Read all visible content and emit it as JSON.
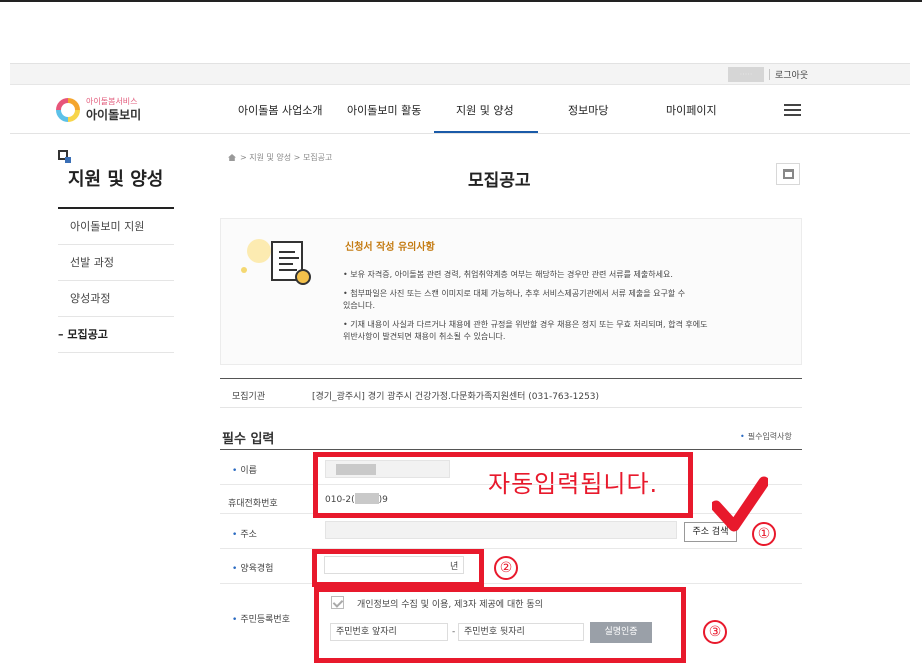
{
  "utility": {
    "user_masked": "·····",
    "logout": "로그아웃"
  },
  "logo": {
    "service": "아이돌봄서비스",
    "name": "아이돌보미"
  },
  "gnb": {
    "items": [
      "아이돌봄 사업소개",
      "아이돌보미 활동",
      "지원 및 양성",
      "정보마당",
      "마이페이지"
    ],
    "active_index": 2
  },
  "sidebar": {
    "title": "지원 및 양성",
    "items": [
      "아이돌보미 지원",
      "선발 과정",
      "양성과정",
      "모집공고"
    ],
    "active_prefix": "– "
  },
  "breadcrumb": [
    "지원 및 양성",
    "모집공고"
  ],
  "page_title": "모집공고",
  "notice": {
    "title": "신청서 작성 유의사항",
    "lines": [
      "• 보유 자격증, 아이돌봄 관련 경력, 취업취약계층 여부는 해당하는 경우만 관련 서류를 제출하세요.",
      "• 첨부파일은 사진 또는 스캔 이미지로 대체 가능하나, 추후 서비스제공기관에서 서류 제출을 요구할 수",
      "  있습니다.",
      "• 기재 내용이 사실과 다르거나 채용에 관한 규정을 위반할 경우 채용은 정지 또는 무효 처리되며, 합격 후에도",
      "  위반사항이 발견되면 채용이 취소될 수 있습니다."
    ]
  },
  "agency": {
    "label": "모집기관",
    "value": "[경기_광주시] 경기 광주시 건강가정.다문화가족지원센터 (031-763-1253)"
  },
  "form": {
    "heading": "필수 입력",
    "required_note": "필수입력사항",
    "name_label": "이름",
    "phone_label": "휴대전화번호",
    "phone_value_prefix": "010-2(",
    "phone_value_suffix": ")9",
    "address_label": "주소",
    "address_button": "주소 검색",
    "experience_label": "양육경험",
    "experience_unit": "년",
    "rrn_label": "주민등록번호",
    "consent_text": "개인정보의 수집 및 이용, 제3자 제공에 대한 동의",
    "rrn_front_placeholder": "주민번호 앞자리",
    "rrn_separator": "-",
    "rrn_back_placeholder": "주민번호 뒷자리",
    "verify_button": "실명인증"
  },
  "annotations": {
    "auto_text": "자동입력됩니다.",
    "marker_1": "①",
    "marker_2": "②",
    "marker_3": "③",
    "color": "#e8192c"
  },
  "colors": {
    "accent": "#1a5aa8",
    "notice_title": "#c47b12"
  }
}
